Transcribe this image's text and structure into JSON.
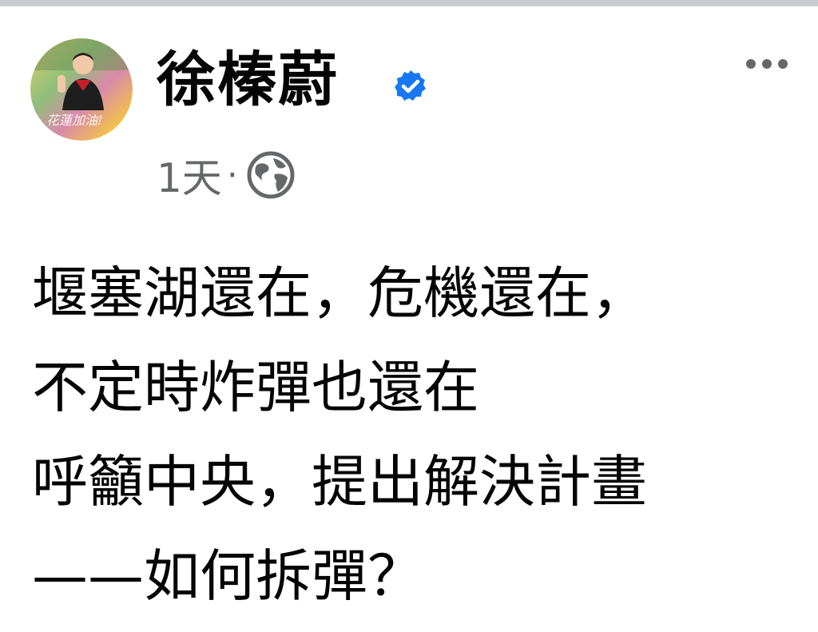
{
  "post": {
    "author": {
      "name": "徐榛蔚",
      "verified": true,
      "avatar_caption": "花蓮加油!"
    },
    "meta": {
      "time": "1天",
      "separator": "·",
      "audience_icon": "globe-icon"
    },
    "more_icon": "more-options-icon",
    "message_lines": [
      "堰塞湖還在，危機還在，",
      "不定時炸彈也還在",
      "呼籲中央，提出解決計畫",
      "——如何拆彈？"
    ]
  },
  "colors": {
    "text_primary": "#050505",
    "text_secondary": "#65676b",
    "verified_blue": "#1877f2",
    "top_strip": "#c9ccd1"
  }
}
